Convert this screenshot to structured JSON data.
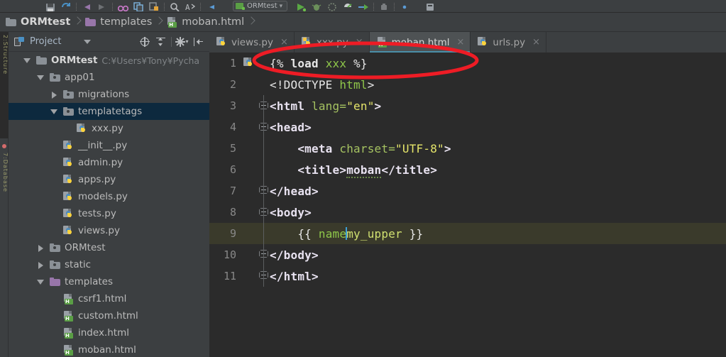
{
  "window": {
    "app": "PyCharm",
    "theme_bg": "#3c3f41",
    "editor_bg": "#2b2b2b",
    "accent": "#4a8fa8",
    "selection_bg": "#0d293e",
    "annotation_color": "#ee1c25"
  },
  "toolbar": {
    "run_config": "ORMtest",
    "icons": [
      "save-icon",
      "sync-icon",
      "back-arrow-icon",
      "forward-arrow-icon",
      "binoculars-icon",
      "copy-icon",
      "paste-icon",
      "search-icon",
      "replace-icon",
      "run-icon",
      "debug-icon",
      "coverage-icon",
      "profile-icon",
      "attach-icon",
      "stop-icon",
      "settings-dot-icon",
      "help-icon"
    ]
  },
  "breadcrumb": {
    "items": [
      {
        "label": "ORMtest",
        "icon": "folder-gray-icon"
      },
      {
        "label": "templates",
        "icon": "folder-purple-icon"
      },
      {
        "label": "moban.html",
        "icon": "html-file-icon"
      }
    ]
  },
  "project_panel": {
    "title": "Project",
    "actions": [
      "scroll-from-source-icon",
      "collapse-all-icon",
      "settings-gear-icon",
      "hide-panel-icon"
    ]
  },
  "tree": [
    {
      "label": "ORMtest",
      "path": "C:¥Users¥Tony¥Pycha",
      "icon": "folder-gray-icon",
      "toggle": "down",
      "indent": 0,
      "selected": false,
      "bold": true
    },
    {
      "label": "app01",
      "path": "",
      "icon": "folder-module-icon",
      "toggle": "down",
      "indent": 1,
      "selected": false,
      "bold": false
    },
    {
      "label": "migrations",
      "path": "",
      "icon": "folder-module-icon",
      "toggle": "right",
      "indent": 2,
      "selected": false,
      "bold": false
    },
    {
      "label": "templatetags",
      "path": "",
      "icon": "folder-module-icon",
      "toggle": "down",
      "indent": 2,
      "selected": true,
      "bold": false
    },
    {
      "label": "xxx.py",
      "path": "",
      "icon": "python-file-icon",
      "toggle": "none",
      "indent": 4,
      "selected": false,
      "bold": false
    },
    {
      "label": "__init__.py",
      "path": "",
      "icon": "python-file-icon",
      "toggle": "none",
      "indent": 3,
      "selected": false,
      "bold": false
    },
    {
      "label": "admin.py",
      "path": "",
      "icon": "python-file-icon",
      "toggle": "none",
      "indent": 3,
      "selected": false,
      "bold": false
    },
    {
      "label": "apps.py",
      "path": "",
      "icon": "python-file-icon",
      "toggle": "none",
      "indent": 3,
      "selected": false,
      "bold": false
    },
    {
      "label": "models.py",
      "path": "",
      "icon": "python-file-icon",
      "toggle": "none",
      "indent": 3,
      "selected": false,
      "bold": false
    },
    {
      "label": "tests.py",
      "path": "",
      "icon": "python-file-icon",
      "toggle": "none",
      "indent": 3,
      "selected": false,
      "bold": false
    },
    {
      "label": "views.py",
      "path": "",
      "icon": "python-file-icon",
      "toggle": "none",
      "indent": 3,
      "selected": false,
      "bold": false
    },
    {
      "label": "ORMtest",
      "path": "",
      "icon": "folder-module-icon",
      "toggle": "right",
      "indent": 1,
      "selected": false,
      "bold": false
    },
    {
      "label": "static",
      "path": "",
      "icon": "folder-module-icon",
      "toggle": "right",
      "indent": 1,
      "selected": false,
      "bold": false
    },
    {
      "label": "templates",
      "path": "",
      "icon": "folder-purple-icon",
      "toggle": "down",
      "indent": 1,
      "selected": false,
      "bold": false
    },
    {
      "label": "csrf1.html",
      "path": "",
      "icon": "html-file-icon",
      "toggle": "none",
      "indent": 3,
      "selected": false,
      "bold": false
    },
    {
      "label": "custom.html",
      "path": "",
      "icon": "html-file-icon",
      "toggle": "none",
      "indent": 3,
      "selected": false,
      "bold": false
    },
    {
      "label": "index.html",
      "path": "",
      "icon": "html-file-icon",
      "toggle": "none",
      "indent": 3,
      "selected": false,
      "bold": false
    },
    {
      "label": "moban.html",
      "path": "",
      "icon": "html-file-icon",
      "toggle": "none",
      "indent": 3,
      "selected": false,
      "bold": false
    }
  ],
  "editor_tabs": [
    {
      "label": "views.py",
      "icon": "python-file-icon",
      "active": false,
      "modified": false
    },
    {
      "label": "xxx.py",
      "icon": "python-file-icon",
      "active": false,
      "modified": true
    },
    {
      "label": "moban.html",
      "icon": "html-file-icon",
      "active": true,
      "modified": false
    },
    {
      "label": "urls.py",
      "icon": "python-file-icon",
      "active": false,
      "modified": false
    }
  ],
  "editor": {
    "file": "moban.html",
    "current_line": 9,
    "lines": [
      {
        "n": "1",
        "fold": "none",
        "icon": "python-file-icon",
        "highlight": false,
        "text": "{% load xxx %}"
      },
      {
        "n": "2",
        "fold": "none",
        "icon": "",
        "highlight": false,
        "text": "<!DOCTYPE html>"
      },
      {
        "n": "3",
        "fold": "open",
        "icon": "",
        "highlight": false,
        "text": "<html lang=\"en\">"
      },
      {
        "n": "4",
        "fold": "open",
        "icon": "",
        "highlight": false,
        "text": "<head>"
      },
      {
        "n": "5",
        "fold": "none",
        "icon": "",
        "highlight": false,
        "text": "    <meta charset=\"UTF-8\">"
      },
      {
        "n": "6",
        "fold": "none",
        "icon": "",
        "highlight": false,
        "text": "    <title>moban</title>"
      },
      {
        "n": "7",
        "fold": "close",
        "icon": "",
        "highlight": false,
        "text": "</head>"
      },
      {
        "n": "8",
        "fold": "open",
        "icon": "",
        "highlight": false,
        "text": "<body>"
      },
      {
        "n": "9",
        "fold": "none",
        "icon": "",
        "highlight": true,
        "text": "    {{ name|my_upper }}"
      },
      {
        "n": "10",
        "fold": "close",
        "icon": "",
        "highlight": false,
        "text": "</body>"
      },
      {
        "n": "11",
        "fold": "close",
        "icon": "",
        "highlight": false,
        "text": "</html>"
      }
    ]
  },
  "annotation": {
    "shape": "ellipse",
    "color": "#ee1c25",
    "targets_line": 1,
    "target_text": "{% load xxx %}"
  }
}
